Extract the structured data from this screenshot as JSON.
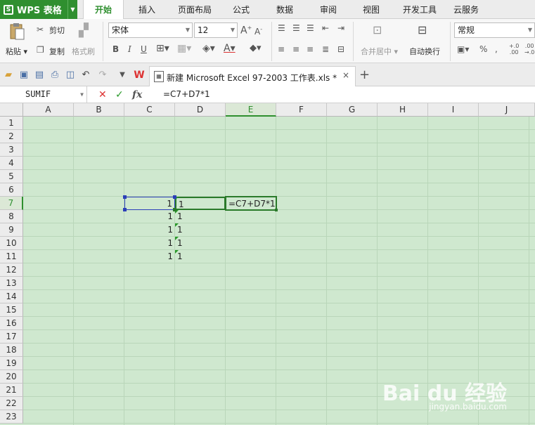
{
  "app": {
    "name": "WPS 表格",
    "logo": "S"
  },
  "menu_tabs": [
    "开始",
    "插入",
    "页面布局",
    "公式",
    "数据",
    "审阅",
    "视图",
    "开发工具",
    "云服务"
  ],
  "active_tab": "开始",
  "ribbon": {
    "paste": "粘贴",
    "cut": "剪切",
    "copy": "复制",
    "format_painter": "格式刷",
    "font_name": "宋体",
    "font_size": "12",
    "merge_center": "合并居中",
    "wrap_text": "自动换行",
    "number_format": "常规"
  },
  "document": {
    "tab_title": "新建 Microsoft Excel 97-2003 工作表.xls *"
  },
  "formula_bar": {
    "name_box": "SUMIF",
    "formula": "=C7+D7*1"
  },
  "columns": [
    "A",
    "B",
    "C",
    "D",
    "E",
    "F",
    "G",
    "H",
    "I",
    "J"
  ],
  "selected_column": "E",
  "rows": [
    "1",
    "2",
    "3",
    "4",
    "5",
    "6",
    "7",
    "8",
    "9",
    "10",
    "11",
    "12",
    "13",
    "14",
    "15",
    "16",
    "17",
    "18",
    "19",
    "20",
    "21",
    "22",
    "23"
  ],
  "selected_row": "7",
  "cells": {
    "C7": "1",
    "D7": "1",
    "E7": "=C7+D7*1",
    "C8": "1",
    "D8": "1",
    "C9": "1",
    "D9": "1",
    "C10": "1",
    "D10": "1",
    "C11": "1",
    "D11": "1"
  },
  "watermark": {
    "brand": "Bai du 经验",
    "url": "jingyan.baidu.com"
  },
  "colors": {
    "accent": "#2f8f2f",
    "grid_bg": "#cfe8cf",
    "selection_blue": "#2b3fb8"
  }
}
